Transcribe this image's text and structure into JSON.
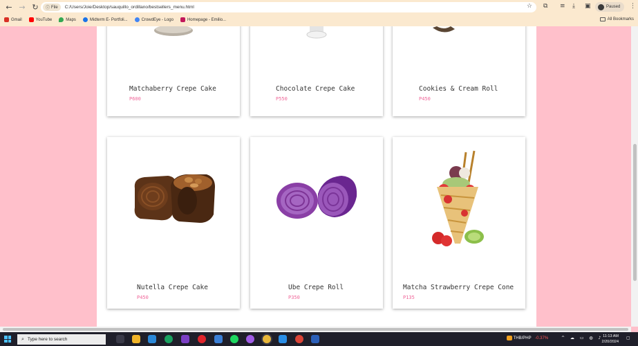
{
  "browser": {
    "file_chip": "File",
    "url": "C:/Users/Joie/Desktop/sauquillo_ordillano/bestsellers_menu.html",
    "profile_label": "Paused",
    "bookmarks": [
      "Gmail",
      "YouTube",
      "Maps",
      "Midterm E- Portfoli...",
      "CrowdEye - Logo",
      "Homepage - Emilio..."
    ],
    "bookmark_colors": [
      "#d93025",
      "#ff0000",
      "#34a853",
      "#1a73e8",
      "#4285f4",
      "#c2185b"
    ],
    "all_bookmarks": "All Bookmarks"
  },
  "menu": {
    "price_color": "#f0679a",
    "items": [
      {
        "name": "Matchaberry Crepe Cake",
        "price": "P600"
      },
      {
        "name": "Chocolate Crepe Cake",
        "price": "P550"
      },
      {
        "name": "Cookies & Cream Roll",
        "price": "P450"
      },
      {
        "name": "Nutella Crepe Cake",
        "price": "P450"
      },
      {
        "name": "Ube Crepe Roll",
        "price": "P350"
      },
      {
        "name": "Matcha Strawberry Crepe Cone",
        "price": "P135"
      }
    ]
  },
  "taskbar": {
    "search_placeholder": "Type here to search",
    "currency": "THB/PHP",
    "currency_change": "-0.37%",
    "time": "11:13 AM",
    "date": "2/20/2024"
  }
}
